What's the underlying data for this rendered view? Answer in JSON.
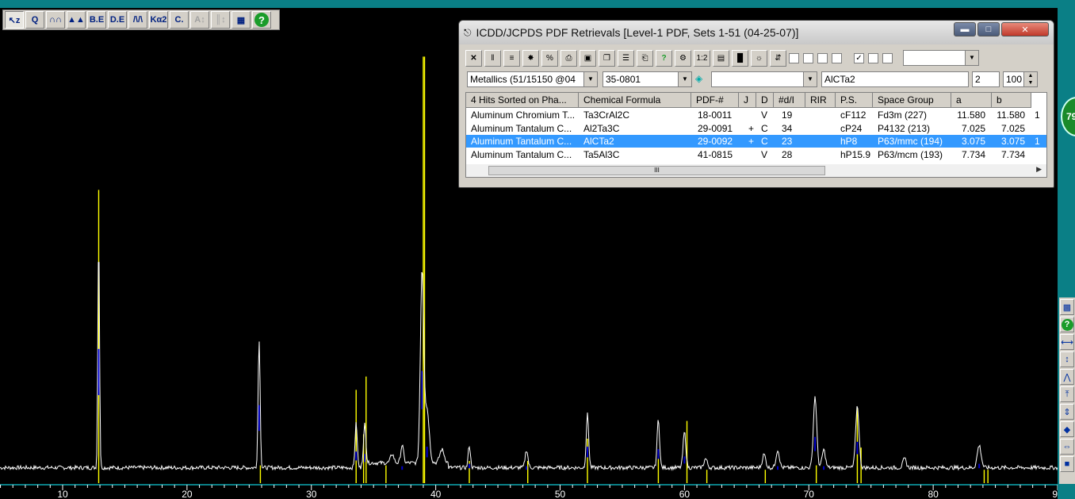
{
  "colors": {
    "accent": "#3399ff",
    "trace": "#ffffff",
    "ref_line": "#ffff00",
    "match_line": "#0000cc",
    "background": "#000000"
  },
  "plot": {
    "x_ticks": [
      "10",
      "20",
      "30",
      "40",
      "50",
      "60",
      "70",
      "80",
      "90"
    ],
    "x_range": [
      5,
      90
    ],
    "reference_lines": [
      {
        "two_theta": 12.9,
        "height": 0.66
      },
      {
        "two_theta": 25.9,
        "height": 0.04
      },
      {
        "two_theta": 33.6,
        "height": 0.21
      },
      {
        "two_theta": 34.2,
        "height": 0.11
      },
      {
        "two_theta": 34.4,
        "height": 0.24
      },
      {
        "two_theta": 36.0,
        "height": 0.04
      },
      {
        "two_theta": 39.0,
        "height": 0.96
      },
      {
        "two_theta": 39.1,
        "height": 0.96
      },
      {
        "two_theta": 42.7,
        "height": 0.05
      },
      {
        "two_theta": 47.4,
        "height": 0.05
      },
      {
        "two_theta": 52.2,
        "height": 0.1
      },
      {
        "two_theta": 57.9,
        "height": 0.06
      },
      {
        "two_theta": 60.2,
        "height": 0.14
      },
      {
        "two_theta": 61.8,
        "height": 0.03
      },
      {
        "two_theta": 66.5,
        "height": 0.03
      },
      {
        "two_theta": 70.6,
        "height": 0.04
      },
      {
        "two_theta": 73.9,
        "height": 0.17
      },
      {
        "two_theta": 74.2,
        "height": 0.08
      },
      {
        "two_theta": 84.1,
        "height": 0.03
      },
      {
        "two_theta": 84.4,
        "height": 0.03
      }
    ],
    "peaks": [
      {
        "two_theta": 12.9,
        "height": 0.52,
        "width": 0.15
      },
      {
        "two_theta": 25.8,
        "height": 0.29,
        "width": 0.18
      },
      {
        "two_theta": 33.6,
        "height": 0.1,
        "width": 0.2
      },
      {
        "two_theta": 34.3,
        "height": 0.09,
        "width": 0.2
      },
      {
        "two_theta": 36.5,
        "height": 0.02,
        "width": 0.3
      },
      {
        "two_theta": 37.3,
        "height": 0.04,
        "width": 0.25
      },
      {
        "two_theta": 38.9,
        "height": 0.43,
        "width": 0.3
      },
      {
        "two_theta": 39.3,
        "height": 0.12,
        "width": 0.4
      },
      {
        "two_theta": 40.5,
        "height": 0.03,
        "width": 0.4
      },
      {
        "two_theta": 42.7,
        "height": 0.05,
        "width": 0.2
      },
      {
        "two_theta": 47.3,
        "height": 0.04,
        "width": 0.25
      },
      {
        "two_theta": 52.2,
        "height": 0.12,
        "width": 0.22
      },
      {
        "two_theta": 57.9,
        "height": 0.11,
        "width": 0.22
      },
      {
        "two_theta": 60.0,
        "height": 0.08,
        "width": 0.25
      },
      {
        "two_theta": 61.7,
        "height": 0.02,
        "width": 0.3
      },
      {
        "two_theta": 66.4,
        "height": 0.03,
        "width": 0.3
      },
      {
        "two_theta": 67.5,
        "height": 0.04,
        "width": 0.3
      },
      {
        "two_theta": 70.5,
        "height": 0.16,
        "width": 0.3
      },
      {
        "two_theta": 71.2,
        "height": 0.04,
        "width": 0.3
      },
      {
        "two_theta": 73.9,
        "height": 0.14,
        "width": 0.3
      },
      {
        "two_theta": 77.7,
        "height": 0.02,
        "width": 0.3
      },
      {
        "two_theta": 83.7,
        "height": 0.05,
        "width": 0.35
      }
    ]
  },
  "toolbar": {
    "buttons": [
      {
        "name": "select-tool-button",
        "label": "↖z"
      },
      {
        "name": "zoom-tool-button",
        "label": "Q"
      },
      {
        "name": "peak-pick-button",
        "label": "∩∩"
      },
      {
        "name": "peak-fill-button",
        "label": "▲▲"
      },
      {
        "name": "background-edit-button",
        "label": "B.E"
      },
      {
        "name": "data-edit-button",
        "label": "D.E"
      },
      {
        "name": "profile-fit-button",
        "label": "/\\/\\"
      },
      {
        "name": "ka2-strip-button",
        "label": "Kα2"
      },
      {
        "name": "calculate-button",
        "label": "C."
      },
      {
        "name": "auto-scale-button",
        "label": "A↕"
      },
      {
        "name": "bar-scale-button",
        "label": "║↕"
      },
      {
        "name": "grid-view-button",
        "label": "▦"
      }
    ]
  },
  "badge": {
    "label": "79"
  },
  "window": {
    "title": "ICDD/JCPDS PDF Retrievals [Level-1 PDF, Sets 1-51 (04-25-07)]",
    "toolbar_icons": [
      "close-x-icon",
      "bar-plot-icon",
      "list-icon",
      "color-wheel-icon",
      "percent-icon",
      "print-icon",
      "save-icon",
      "copy-icon",
      "report-icon",
      "open-folder-icon",
      "help-icon",
      "gear-icon",
      "ratio-icon",
      "compare-icon",
      "color-bars-icon",
      "sun-icon",
      "sort-icon"
    ],
    "toolbar_glyphs": [
      "✕",
      "‖",
      "≡",
      "✸",
      "%",
      "⎙",
      "▣",
      "❐",
      "☰",
      "⎗",
      "?",
      "⚙",
      "1:2",
      "▤",
      "█",
      "☼",
      "⇵"
    ],
    "checkboxes": [
      false,
      false,
      false,
      false,
      true,
      false,
      false
    ],
    "subfile_combo": "Metallics (51/15150 @04",
    "pdf_number_combo": "35-0801",
    "element_combo": "",
    "formula_input": "AlCTa2",
    "min_elements": "2",
    "max_hits": "100",
    "columns": [
      "4 Hits Sorted on Pha...",
      "Chemical Formula",
      "PDF-#",
      "J",
      "D",
      "#d/I",
      "RIR",
      "P.S.",
      "Space Group",
      "a",
      "b"
    ],
    "rows": [
      {
        "name": "Aluminum Chromium T...",
        "formula": "Ta3CrAl2C",
        "pdf": "18-0011",
        "j": "",
        "d": "V",
        "di": "19",
        "rir": "",
        "ps": "cF112",
        "sg": "Fd3m (227)",
        "a": "11.580",
        "b": "11.580",
        "more": "1"
      },
      {
        "name": "Aluminum Tantalum C...",
        "formula": "Al2Ta3C",
        "pdf": "29-0091",
        "j": "+",
        "d": "C",
        "di": "34",
        "rir": "",
        "ps": "cP24",
        "sg": "P4132 (213)",
        "a": "7.025",
        "b": "7.025",
        "more": ""
      },
      {
        "name": "Aluminum Tantalum C...",
        "formula": "AlCTa2",
        "pdf": "29-0092",
        "j": "+",
        "d": "C",
        "di": "23",
        "rir": "",
        "ps": "hP8",
        "sg": "P63/mmc (194)",
        "a": "3.075",
        "b": "3.075",
        "more": "1"
      },
      {
        "name": "Aluminum Tantalum C...",
        "formula": "Ta5Al3C",
        "pdf": "41-0815",
        "j": "",
        "d": "V",
        "di": "28",
        "rir": "",
        "ps": "hP15.9",
        "sg": "P63/mcm (193)",
        "a": "7.734",
        "b": "7.734",
        "more": ""
      }
    ],
    "scroll_thumb": "III"
  }
}
